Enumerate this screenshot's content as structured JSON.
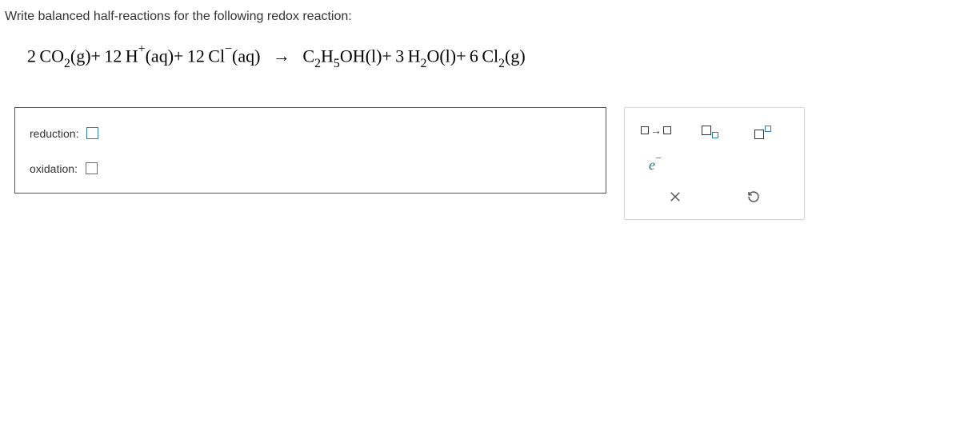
{
  "question": "Write balanced half-reactions for the following redox reaction:",
  "equation": {
    "lhs": {
      "term1_coef": "2",
      "term1_formula_base": "CO",
      "term1_formula_sub": "2",
      "term1_state": "(g)",
      "plus1": "+",
      "term2_coef": "12",
      "term2_formula": "H",
      "term2_charge": "+",
      "term2_state": "(aq)",
      "plus2": "+",
      "term3_coef": "12",
      "term3_formula": "Cl",
      "term3_charge": "−",
      "term3_state": "(aq)"
    },
    "arrow": "→",
    "rhs": {
      "term1_formula_c": "C",
      "term1_formula_sub1": "2",
      "term1_formula_h": "H",
      "term1_formula_sub2": "5",
      "term1_formula_oh": "OH",
      "term1_state": "(l)",
      "plus1": "+",
      "term2_coef": "3",
      "term2_formula_h": "H",
      "term2_formula_sub": "2",
      "term2_formula_o": "O",
      "term2_state": "(l)",
      "plus2": "+",
      "term3_coef": "6",
      "term3_formula_cl": "Cl",
      "term3_formula_sub": "2",
      "term3_state": "(g)"
    }
  },
  "answers": {
    "reduction_label": "reduction:",
    "oxidation_label": "oxidation:"
  },
  "palette": {
    "electron": "e",
    "electron_minus": "−"
  }
}
